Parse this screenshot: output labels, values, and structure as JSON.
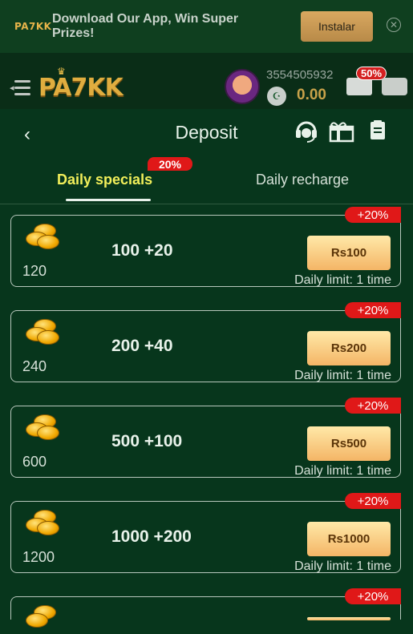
{
  "banner": {
    "logo": "PA7KK",
    "promo_text": "Download Our App, Win Super Prizes!",
    "install_label": "Instalar",
    "close_icon": "close-icon"
  },
  "topbar": {
    "brand": "PA7KK",
    "phone": "3554505932",
    "balance": "0.00",
    "promo_badge": "50%"
  },
  "header": {
    "title": "Deposit",
    "icons": [
      "headset-icon",
      "gift-icon",
      "document-icon"
    ]
  },
  "tabs": [
    {
      "label": "Daily specials",
      "badge": "20%",
      "active": true
    },
    {
      "label": "Daily recharge",
      "active": false
    }
  ],
  "offers": [
    {
      "coins": "120",
      "bonus": "100 +20",
      "price": "Rs100",
      "limit_label": "Daily limit:",
      "limit_value": "1 time",
      "percent": "+20%"
    },
    {
      "coins": "240",
      "bonus": "200 +40",
      "price": "Rs200",
      "limit_label": "Daily limit:",
      "limit_value": "1 time",
      "percent": "+20%"
    },
    {
      "coins": "600",
      "bonus": "500 +100",
      "price": "Rs500",
      "limit_label": "Daily limit:",
      "limit_value": "1 time",
      "percent": "+20%"
    },
    {
      "coins": "1200",
      "bonus": "1000 +200",
      "price": "Rs1000",
      "limit_label": "Daily limit:",
      "limit_value": "1 time",
      "percent": "+20%"
    },
    {
      "coins": "",
      "bonus": "",
      "price": "",
      "limit_label": "",
      "limit_value": "",
      "percent": "+20%"
    }
  ],
  "colors": {
    "background": "#07361c",
    "active_tab": "#f2ef5a",
    "badge_red": "#e01818",
    "button_gold": "#f4b566"
  }
}
